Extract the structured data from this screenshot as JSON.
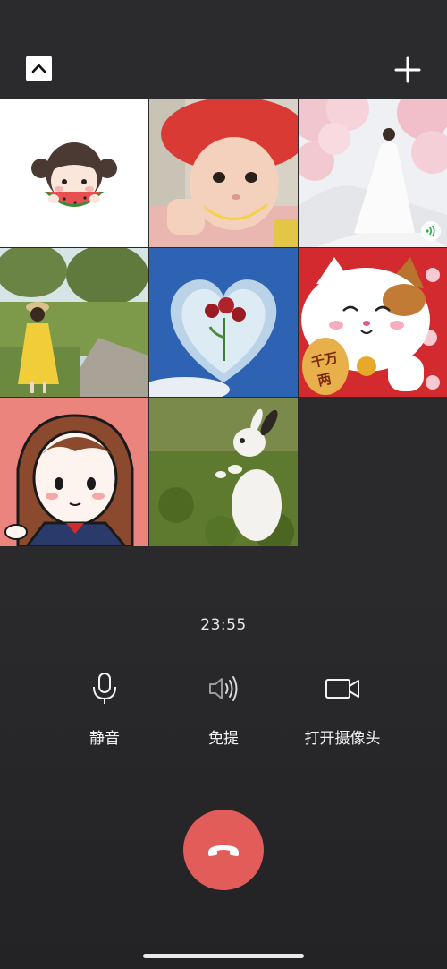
{
  "call": {
    "timer": "23:55"
  },
  "top_bar": {
    "collapse_icon": "chevron-up-icon",
    "add_icon": "plus-icon"
  },
  "participants": [
    {
      "avatar": "watermelon-girl-cartoon"
    },
    {
      "avatar": "baby-red-hat"
    },
    {
      "avatar": "bride-cherry-blossom",
      "badge": "speaking-signal-icon"
    },
    {
      "avatar": "girl-yellow-dress-road"
    },
    {
      "avatar": "glass-heart-roses"
    },
    {
      "avatar": "lucky-cat",
      "text": "千万两"
    },
    {
      "avatar": "cartoon-girl-brown-hair"
    },
    {
      "avatar": "white-rabbit-grass"
    }
  ],
  "controls": {
    "mute_label": "静音",
    "speaker_label": "免提",
    "camera_label": "打开摄像头"
  },
  "colors": {
    "background": "#2c2c2e",
    "hangup": "#e25c59",
    "speaking": "#20b04a"
  }
}
